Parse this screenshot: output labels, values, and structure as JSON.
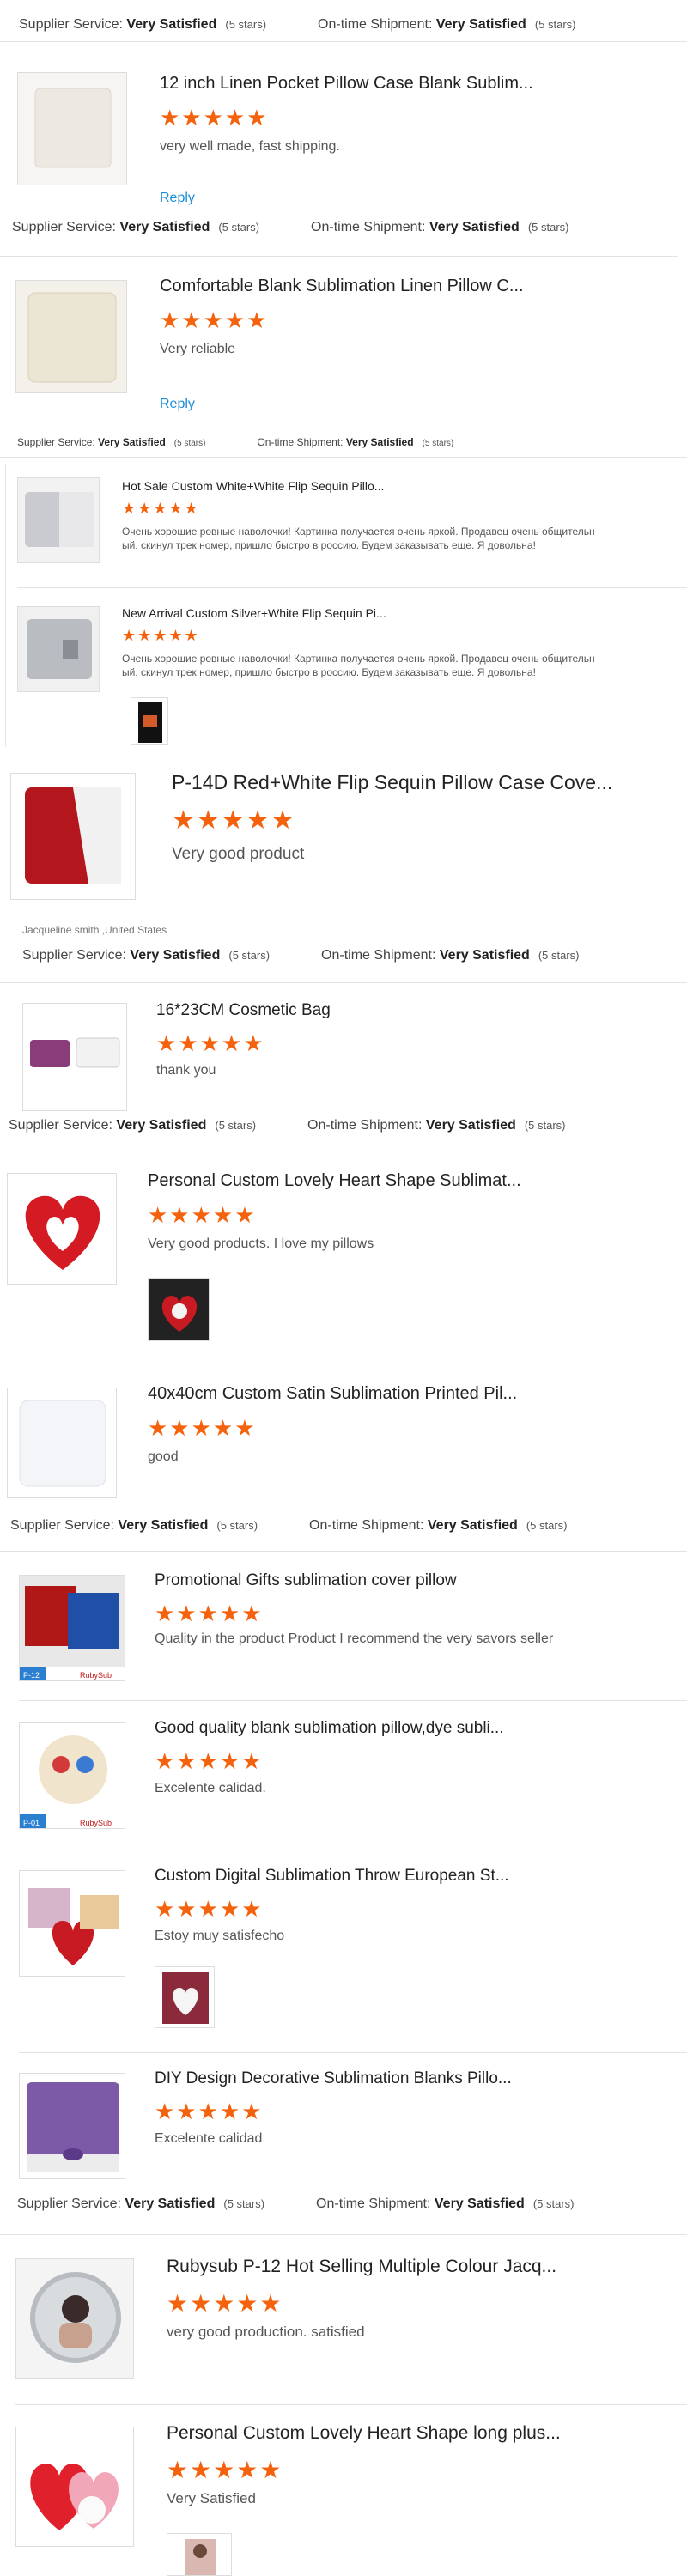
{
  "labels": {
    "supplier": "Supplier Service:",
    "shipment": "On-time Shipment:",
    "very_satisfied": "Very Satisfied",
    "five_stars": "(5 stars)",
    "reply": "Reply"
  },
  "stars_glyph": "★★★★★",
  "reviews": [
    {
      "title": "12 inch Linen Pocket Pillow Case Blank Sublim...",
      "comment": "very well made, fast shipping."
    },
    {
      "title": "Comfortable Blank Sublimation Linen Pillow C...",
      "comment": "Very reliable"
    },
    {
      "title": "Hot Sale Custom White+White Flip Sequin Pillo...",
      "comment": "Очень хорошие ровные наволочки!  Картинка получается очень яркой.   Продавец очень общительн",
      "comment2": "ый, скинул трек  номер, пришло быстро в россию.  Будем заказывать еще.  Я довольна!"
    },
    {
      "title": "New Arrival Custom Silver+White Flip Sequin Pi...",
      "comment": "Очень хорошие ровные наволочки!  Картинка получается очень яркой.   Продавец очень общительн",
      "comment2": "ый, скинул трек  номер, пришло быстро в россию.  Будем заказывать еще.  Я довольна!"
    },
    {
      "title": "P-14D Red+White Flip Sequin Pillow Case Cove...",
      "comment": "Very good product",
      "author": "Jacqueline smith ,United States"
    },
    {
      "title": "16*23CM Cosmetic Bag",
      "comment": "thank you"
    },
    {
      "title": "Personal Custom Lovely Heart Shape Sublimat...",
      "comment": "Very good products. I love my pillows"
    },
    {
      "title": "40x40cm Custom Satin Sublimation Printed Pil...",
      "comment": "good"
    },
    {
      "title": "Promotional Gifts sublimation cover pillow",
      "comment": "Quality in the product Product I recommend the very savors seller"
    },
    {
      "title": "Good quality blank sublimation pillow,dye subli...",
      "comment": "Excelente calidad."
    },
    {
      "title": "Custom Digital Sublimation Throw European St...",
      "comment": "Estoy muy satisfecho"
    },
    {
      "title": "DIY Design Decorative Sublimation Blanks Pillo...",
      "comment": "Excelente calidad"
    },
    {
      "title": "Rubysub P-12 Hot Selling Multiple Colour Jacq...",
      "comment": "very good production. satisfied"
    },
    {
      "title": "Personal Custom Lovely Heart Shape long plus...",
      "comment": "Very Satisfied"
    }
  ],
  "thumb_tags": {
    "p12": "P-12",
    "p01": "P-01",
    "brand": "RubySub"
  },
  "colors": {
    "star": "#f5620d",
    "link": "#1a8cd8",
    "divider": "#e3e3e3"
  }
}
